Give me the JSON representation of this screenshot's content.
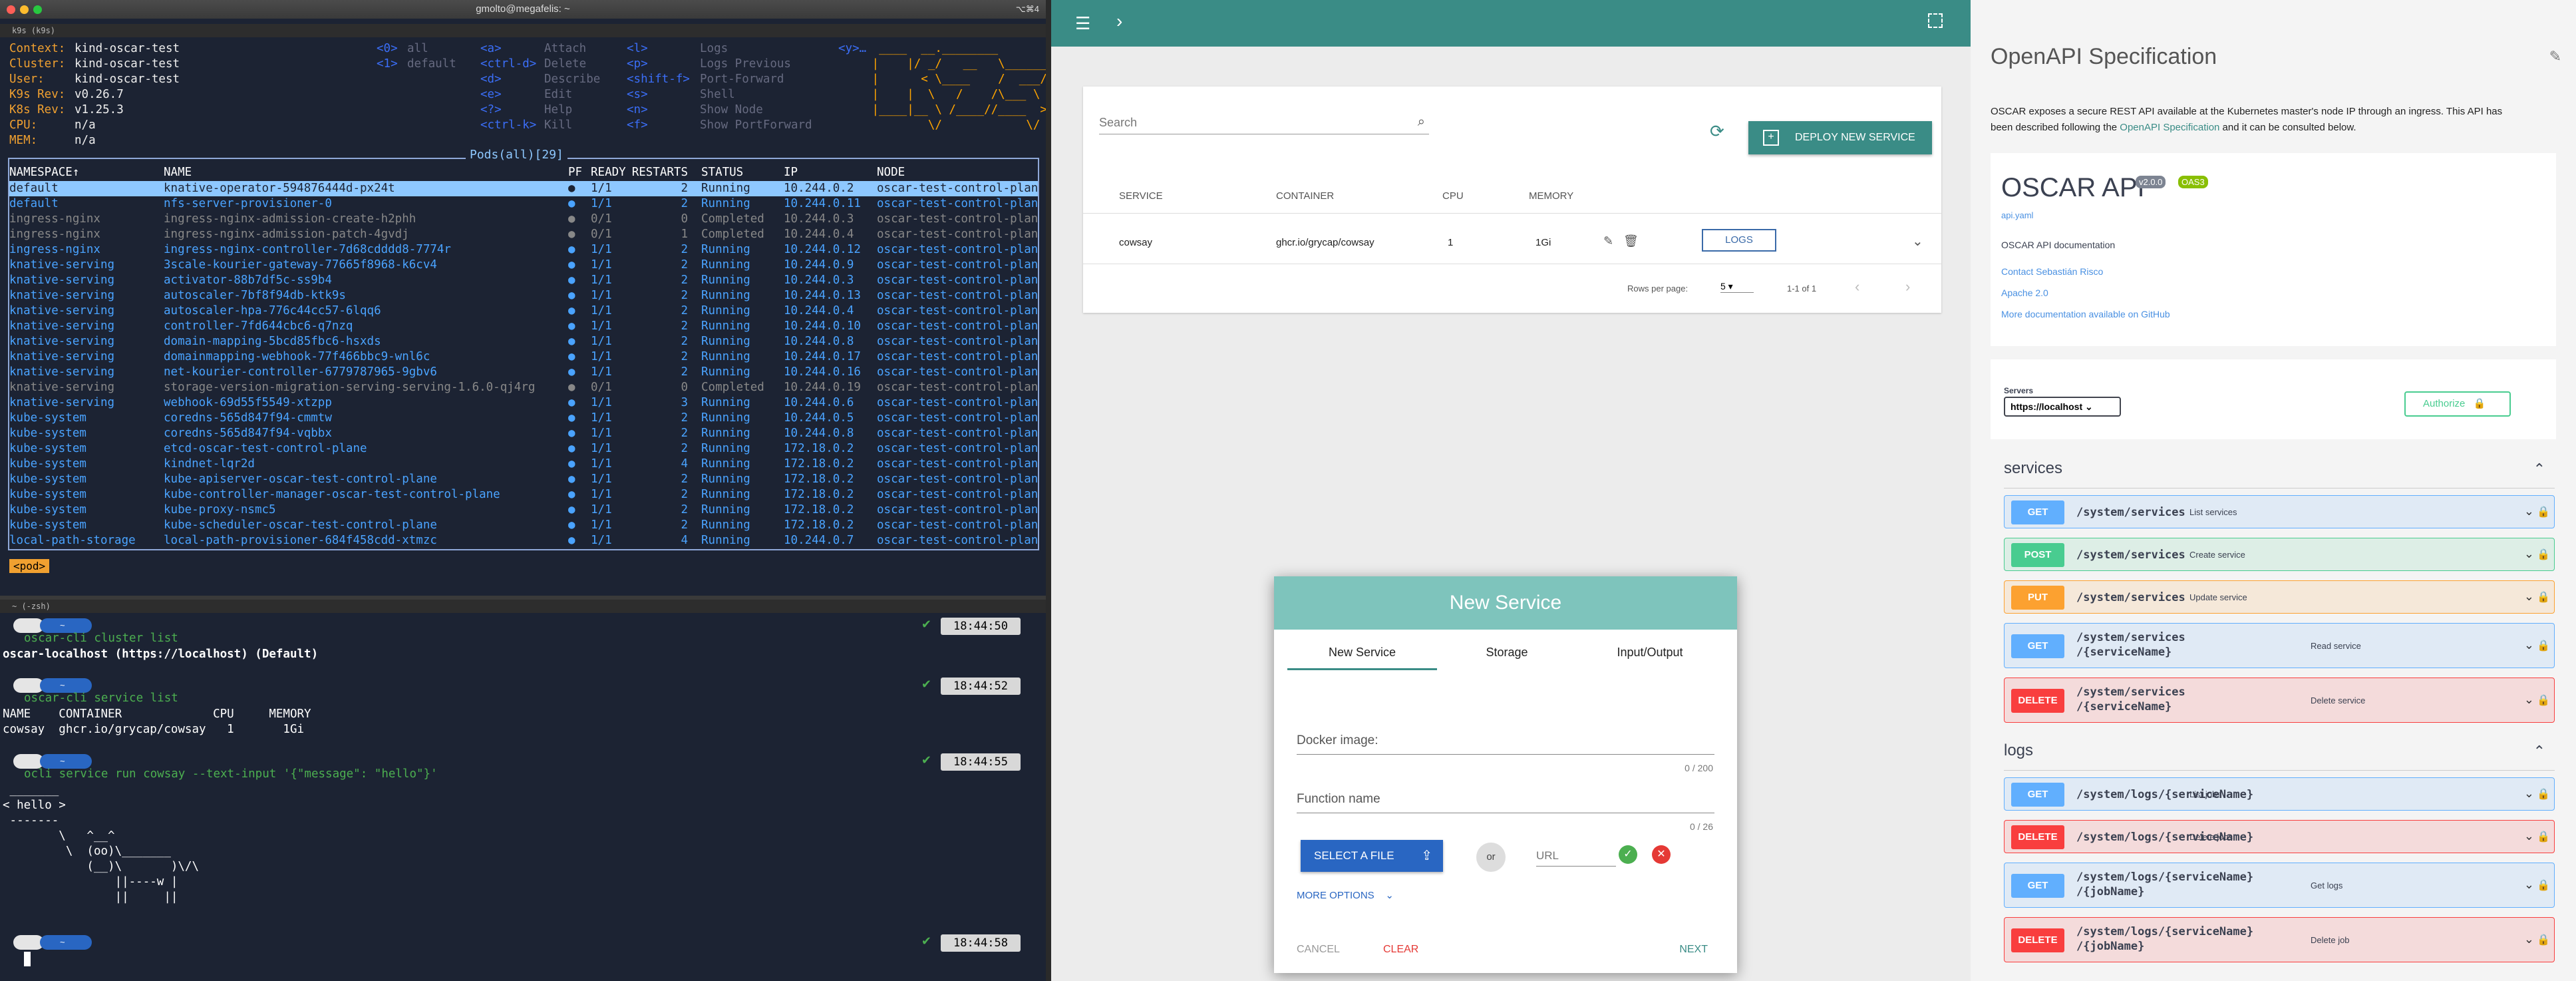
{
  "window": {
    "title": "gmolto@megafelis: ~",
    "shortcut": "⌥⌘4"
  },
  "k9s": {
    "pane_title": "k9s (k9s)",
    "info": [
      [
        "Context:",
        "kind-oscar-test"
      ],
      [
        "Cluster:",
        "kind-oscar-test"
      ],
      [
        "User:",
        "kind-oscar-test"
      ],
      [
        "K9s Rev:",
        "v0.26.7"
      ],
      [
        "K8s Rev:",
        "v1.25.3"
      ],
      [
        "CPU:",
        "n/a"
      ],
      [
        "MEM:",
        "n/a"
      ]
    ],
    "ns_shortcuts": [
      [
        "<0>",
        "all"
      ],
      [
        "<1>",
        "default"
      ]
    ],
    "actions1": [
      [
        "<a>",
        "Attach"
      ],
      [
        "<ctrl-d>",
        "Delete"
      ],
      [
        "<d>",
        "Describe"
      ],
      [
        "<e>",
        "Edit"
      ],
      [
        "<?>",
        "Help"
      ],
      [
        "<ctrl-k>",
        "Kill"
      ]
    ],
    "actions2": [
      [
        "<l>",
        "Logs"
      ],
      [
        "<p>",
        "Logs Previous"
      ],
      [
        "<shift-f>",
        "Port-Forward"
      ],
      [
        "<s>",
        "Shell"
      ],
      [
        "<n>",
        "Show Node"
      ],
      [
        "<f>",
        "Show PortForward"
      ]
    ],
    "actions3": [
      "<y>…"
    ],
    "logo": [
      "  ____  __.________        ",
      " |    |/ _/   __   \\______ ",
      " |      < \\____    /  ___/ ",
      " |    |  \\   /    /\\___ \\  ",
      " |____|__ \\ /____//____  > ",
      "         \\/            \\/  "
    ],
    "pods_title": "Pods(all)[29]",
    "columns": [
      "NAMESPACE↑",
      "NAME",
      "PF",
      "READY",
      "RESTARTS",
      "STATUS",
      "IP",
      "NODE"
    ],
    "pods": [
      [
        "default",
        "knative-operator-594876444d-px24t",
        "●",
        "1/1",
        "2",
        "Running",
        "10.244.0.2",
        "oscar-test-control-plan"
      ],
      [
        "default",
        "nfs-server-provisioner-0",
        "●",
        "1/1",
        "2",
        "Running",
        "10.244.0.11",
        "oscar-test-control-plan"
      ],
      [
        "ingress-nginx",
        "ingress-nginx-admission-create-h2phh",
        "●",
        "0/1",
        "0",
        "Completed",
        "10.244.0.3",
        "oscar-test-control-plan"
      ],
      [
        "ingress-nginx",
        "ingress-nginx-admission-patch-4gvdj",
        "●",
        "0/1",
        "1",
        "Completed",
        "10.244.0.4",
        "oscar-test-control-plan"
      ],
      [
        "ingress-nginx",
        "ingress-nginx-controller-7d68cdddd8-7774r",
        "●",
        "1/1",
        "2",
        "Running",
        "10.244.0.12",
        "oscar-test-control-plan"
      ],
      [
        "knative-serving",
        "3scale-kourier-gateway-77665f8968-k6cv4",
        "●",
        "1/1",
        "2",
        "Running",
        "10.244.0.9",
        "oscar-test-control-plan"
      ],
      [
        "knative-serving",
        "activator-88b7df5c-ss9b4",
        "●",
        "1/1",
        "2",
        "Running",
        "10.244.0.3",
        "oscar-test-control-plan"
      ],
      [
        "knative-serving",
        "autoscaler-7bf8f94db-ktk9s",
        "●",
        "1/1",
        "2",
        "Running",
        "10.244.0.13",
        "oscar-test-control-plan"
      ],
      [
        "knative-serving",
        "autoscaler-hpa-776c44cc57-6lqq6",
        "●",
        "1/1",
        "2",
        "Running",
        "10.244.0.4",
        "oscar-test-control-plan"
      ],
      [
        "knative-serving",
        "controller-7fd644cbc6-q7nzq",
        "●",
        "1/1",
        "2",
        "Running",
        "10.244.0.10",
        "oscar-test-control-plan"
      ],
      [
        "knative-serving",
        "domain-mapping-5bcd85fbc6-hsxds",
        "●",
        "1/1",
        "2",
        "Running",
        "10.244.0.8",
        "oscar-test-control-plan"
      ],
      [
        "knative-serving",
        "domainmapping-webhook-77f466bbc9-wnl6c",
        "●",
        "1/1",
        "2",
        "Running",
        "10.244.0.17",
        "oscar-test-control-plan"
      ],
      [
        "knative-serving",
        "net-kourier-controller-6779787965-9gbv6",
        "●",
        "1/1",
        "2",
        "Running",
        "10.244.0.16",
        "oscar-test-control-plan"
      ],
      [
        "knative-serving",
        "storage-version-migration-serving-serving-1.6.0-qj4rg",
        "●",
        "0/1",
        "0",
        "Completed",
        "10.244.0.19",
        "oscar-test-control-plan"
      ],
      [
        "knative-serving",
        "webhook-69d55f5549-xtzpp",
        "●",
        "1/1",
        "3",
        "Running",
        "10.244.0.6",
        "oscar-test-control-plan"
      ],
      [
        "kube-system",
        "coredns-565d847f94-cmmtw",
        "●",
        "1/1",
        "2",
        "Running",
        "10.244.0.5",
        "oscar-test-control-plan"
      ],
      [
        "kube-system",
        "coredns-565d847f94-vqbbx",
        "●",
        "1/1",
        "2",
        "Running",
        "10.244.0.8",
        "oscar-test-control-plan"
      ],
      [
        "kube-system",
        "etcd-oscar-test-control-plane",
        "●",
        "1/1",
        "2",
        "Running",
        "172.18.0.2",
        "oscar-test-control-plan"
      ],
      [
        "kube-system",
        "kindnet-lqr2d",
        "●",
        "1/1",
        "4",
        "Running",
        "172.18.0.2",
        "oscar-test-control-plan"
      ],
      [
        "kube-system",
        "kube-apiserver-oscar-test-control-plane",
        "●",
        "1/1",
        "2",
        "Running",
        "172.18.0.2",
        "oscar-test-control-plan"
      ],
      [
        "kube-system",
        "kube-controller-manager-oscar-test-control-plane",
        "●",
        "1/1",
        "2",
        "Running",
        "172.18.0.2",
        "oscar-test-control-plan"
      ],
      [
        "kube-system",
        "kube-proxy-nsmc5",
        "●",
        "1/1",
        "2",
        "Running",
        "172.18.0.2",
        "oscar-test-control-plan"
      ],
      [
        "kube-system",
        "kube-scheduler-oscar-test-control-plane",
        "●",
        "1/1",
        "2",
        "Running",
        "172.18.0.2",
        "oscar-test-control-plan"
      ],
      [
        "local-path-storage",
        "local-path-provisioner-684f458cdd-xtmzc",
        "●",
        "1/1",
        "4",
        "Running",
        "10.244.0.7",
        "oscar-test-control-plan"
      ]
    ],
    "crumb": "<pod>"
  },
  "zsh": {
    "pane_title": "~ (-zsh)",
    "prompt_dir": "~",
    "cmd1": "oscar-cli cluster list",
    "out1": "oscar-localhost (https://localhost) (Default)",
    "time1": "18:44:50",
    "cmd2": "oscar-cli service list",
    "time2": "18:44:52",
    "out2a": "NAME    CONTAINER             CPU     MEMORY",
    "out2b": "cowsay  ghcr.io/grycap/cowsay   1       1Gi",
    "cmd3": "ocli service run cowsay --text-input '{\"message\": \"hello\"}'",
    "time3": "18:44:55",
    "cow": [
      " _______",
      "< hello >",
      " -------",
      "        \\   ^__^",
      "         \\  (oo)\\_______",
      "            (__)\\       )\\/\\",
      "                ||----w |",
      "                ||     ||"
    ],
    "time4": "18:44:58",
    "check": "✔"
  },
  "oscar": {
    "search_placeholder": "Search",
    "deploy_label": "DEPLOY NEW SERVICE",
    "columns": [
      "SERVICE",
      "CONTAINER",
      "CPU",
      "MEMORY"
    ],
    "row": {
      "service": "cowsay",
      "container": "ghcr.io/grycap/cowsay",
      "cpu": "1",
      "memory": "1Gi",
      "logs": "LOGS"
    },
    "rows_per_page_label": "Rows per page:",
    "rows_per_page": "5",
    "range": "1-1 of 1",
    "modal": {
      "title": "New Service",
      "tabs": [
        "New Service",
        "Storage",
        "Input/Output"
      ],
      "docker_label": "Docker image:",
      "docker_count": "0 / 200",
      "fn_label": "Function name",
      "fn_count": "0 / 26",
      "select_file": "SELECT A FILE",
      "or": "or",
      "url_placeholder": "URL",
      "more_options": "MORE OPTIONS",
      "cancel": "CANCEL",
      "clear": "CLEAR",
      "next": "NEXT"
    }
  },
  "swagger": {
    "header": "OpenAPI Specification",
    "intro1": "OSCAR exposes a secure REST API available at the Kubernetes master's node IP through an ingress. This API has",
    "intro2a": "been described following the ",
    "intro_link": "OpenAPI Specification",
    "intro2b": " and it can be consulted below.",
    "api_title": "OSCAR API",
    "version": "v2.0.0",
    "oas": "OAS3",
    "yaml_link": "api.yaml",
    "doc_label": "OSCAR API documentation",
    "links": [
      "Contact Sebastián Risco",
      "Apache 2.0",
      "More documentation available on GitHub"
    ],
    "servers_label": "Servers",
    "server": "https://localhost",
    "authorize": "Authorize",
    "sections": [
      {
        "name": "services",
        "ops": [
          {
            "method": "GET",
            "path": "/system/services",
            "path2": "",
            "desc": "List services"
          },
          {
            "method": "POST",
            "path": "/system/services",
            "path2": "",
            "desc": "Create service"
          },
          {
            "method": "PUT",
            "path": "/system/services",
            "path2": "",
            "desc": "Update service"
          },
          {
            "method": "GET",
            "path": "/system/services",
            "path2": "/{serviceName}",
            "desc": "Read service"
          },
          {
            "method": "DELETE",
            "path": "/system/services",
            "path2": "/{serviceName}",
            "desc": "Delete service"
          }
        ]
      },
      {
        "name": "logs",
        "ops": [
          {
            "method": "GET",
            "path": "/system/logs/{serviceName}",
            "path2": "",
            "desc": "List jobs"
          },
          {
            "method": "DELETE",
            "path": "/system/logs/{serviceName}",
            "path2": "",
            "desc": "Delete jobs"
          },
          {
            "method": "GET",
            "path": "/system/logs/{serviceName}",
            "path2": "/{jobName}",
            "desc": "Get logs"
          },
          {
            "method": "DELETE",
            "path": "/system/logs/{serviceName}",
            "path2": "/{jobName}",
            "desc": "Delete job"
          }
        ]
      }
    ],
    "colors": {
      "GET": "#61affe",
      "POST": "#49cc90",
      "PUT": "#fca130",
      "DELETE": "#f93e3e"
    }
  }
}
